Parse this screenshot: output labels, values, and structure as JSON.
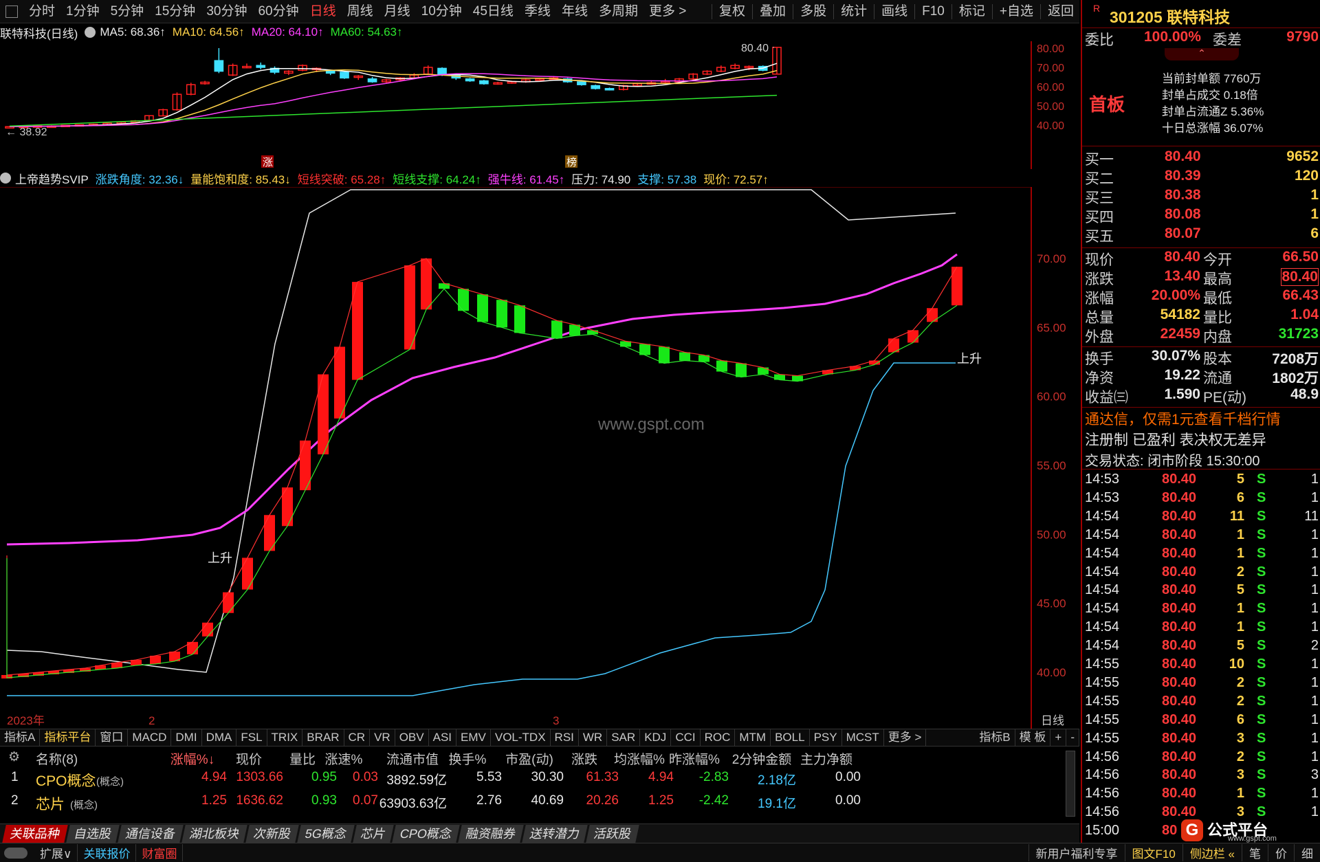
{
  "topbar": {
    "periods": [
      "分时",
      "1分钟",
      "5分钟",
      "15分钟",
      "30分钟",
      "60分钟",
      "日线",
      "周线",
      "月线",
      "10分钟",
      "45日线",
      "季线",
      "年线",
      "多周期",
      "更多 >"
    ],
    "active_period": "日线",
    "tools": [
      "复权",
      "叠加",
      "多股",
      "统计",
      "画线",
      "F10",
      "标记",
      "+自选",
      "返回"
    ]
  },
  "kline": {
    "title": "联特科技(日线)",
    "ma5": "MA5: 68.36↑",
    "ma10": "MA10: 64.56↑",
    "ma20": "MA20: 64.10↑",
    "ma60": "MA60: 54.63↑",
    "y_ticks": [
      "80.00",
      "70.00",
      "60.00",
      "50.00",
      "40.00"
    ],
    "high_label": "80.40",
    "low_label": "38.92",
    "marker_zhang": "涨",
    "marker_bang": "榜",
    "colors": {
      "up": "#ff2020",
      "down": "#40e0ff",
      "ma5": "#ffffff",
      "ma10": "#ffd24a",
      "ma20": "#ff40ff",
      "ma60": "#2ee62e"
    }
  },
  "indicator": {
    "name": "上帝趋势SVIP",
    "items": [
      {
        "text": "涨跌角度: 32.36↓",
        "color": "#45c8ff"
      },
      {
        "text": "量能饱和度: 85.43↓",
        "color": "#ffd24a"
      },
      {
        "text": "短线突破: 65.28↑",
        "color": "#ff3030"
      },
      {
        "text": "短线支撑: 64.24↑",
        "color": "#2ee62e"
      },
      {
        "text": "强牛线: 61.45↑",
        "color": "#ff40ff"
      },
      {
        "text": "压力: 74.90",
        "color": "#e8e8e8"
      },
      {
        "text": "支撑: 57.38",
        "color": "#45c8ff"
      },
      {
        "text": "现价: 72.57↑",
        "color": "#ffd24a"
      }
    ],
    "y_ticks": [
      "70.00",
      "65.00",
      "60.00",
      "55.00",
      "50.00",
      "45.00",
      "40.00"
    ],
    "label_rise": "上升",
    "watermark": "www.gspt.com",
    "x_labels": [
      "2023年",
      "2",
      "3"
    ],
    "period_label": "日线"
  },
  "indicator_tabs": [
    "指标A",
    "指标平台",
    "窗口",
    "MACD",
    "DMI",
    "DMA",
    "FSL",
    "TRIX",
    "BRAR",
    "CR",
    "VR",
    "OBV",
    "ASI",
    "EMV",
    "VOL-TDX",
    "RSI",
    "WR",
    "SAR",
    "KDJ",
    "CCI",
    "ROC",
    "MTM",
    "BOLL",
    "PSY",
    "MCST",
    "更多 >"
  ],
  "indicator_tabs_right": [
    "指标B",
    "模 板",
    "+",
    "-"
  ],
  "table": {
    "headers": [
      "名称(8)",
      "涨幅%↓",
      "现价",
      "量比",
      "涨速%",
      "流通市值",
      "换手%",
      "市盈(动)",
      "涨跌",
      "均涨幅%",
      "昨涨幅%",
      "2分钟金额",
      "主力净额"
    ],
    "rows": [
      {
        "idx": "1",
        "name": "CPO概念",
        "tag": "(概念)",
        "chg": "4.94",
        "price": "1303.66",
        "vr": "0.95",
        "speed": "0.03",
        "mcap": "3892.59亿",
        "turn": "5.53",
        "pe": "30.30",
        "zd": "61.33",
        "avg": "4.94",
        "yest": "-2.83",
        "amt": "2.18亿",
        "net": "0.00"
      },
      {
        "idx": "2",
        "name": "芯片",
        "tag": "(概念)",
        "chg": "1.25",
        "price": "1636.62",
        "vr": "0.93",
        "speed": "0.07",
        "mcap": "63903.63亿",
        "turn": "2.76",
        "pe": "40.69",
        "zd": "20.26",
        "avg": "1.25",
        "yest": "-2.42",
        "amt": "19.1亿",
        "net": "0.00"
      }
    ]
  },
  "bottom_tabs": [
    "关联品种",
    "自选股",
    "通信设备",
    "湖北板块",
    "次新股",
    "5G概念",
    "芯片",
    "CPO概念",
    "融资融券",
    "送转潜力",
    "活跃股"
  ],
  "statusbar": {
    "left": [
      "扩展∨",
      "关联报价",
      "财富圈"
    ],
    "right": [
      "新用户福利专享",
      "图文F10",
      "侧边栏 «",
      "笔",
      "价",
      "细"
    ]
  },
  "quote": {
    "flag": "R",
    "code_name": "301205 联特科技",
    "weibi_label": "委比",
    "weibi_value": "100.00%",
    "weicha_label": "委差",
    "weicha_value": "9790",
    "board": "首板",
    "seal_lines": [
      "当前封单额 7760万",
      "封单占成交 0.18倍",
      "封单占流通Z 5.36%",
      "十日总涨幅 36.07%"
    ],
    "buy": [
      {
        "label": "买一",
        "price": "80.40",
        "vol": "9652"
      },
      {
        "label": "买二",
        "price": "80.39",
        "vol": "120"
      },
      {
        "label": "买三",
        "price": "80.38",
        "vol": "1"
      },
      {
        "label": "买四",
        "price": "80.08",
        "vol": "1"
      },
      {
        "label": "买五",
        "price": "80.07",
        "vol": "6"
      }
    ],
    "stats": [
      {
        "l1": "现价",
        "v1": "80.40",
        "c1": "red",
        "l2": "今开",
        "v2": "66.50",
        "c2": "red"
      },
      {
        "l1": "涨跌",
        "v1": "13.40",
        "c1": "red",
        "l2": "最高",
        "v2": "80.40",
        "c2": "red"
      },
      {
        "l1": "涨幅",
        "v1": "20.00%",
        "c1": "red",
        "l2": "最低",
        "v2": "66.43",
        "c2": "red"
      },
      {
        "l1": "总量",
        "v1": "54182",
        "c1": "yel",
        "l2": "量比",
        "v2": "1.04",
        "c2": "red"
      },
      {
        "l1": "外盘",
        "v1": "22459",
        "c1": "red",
        "l2": "内盘",
        "v2": "31723",
        "c2": "grn"
      }
    ],
    "stats2": [
      {
        "l1": "换手",
        "v1": "30.07%",
        "l2": "股本",
        "v2": "7208万"
      },
      {
        "l1": "净资",
        "v1": "19.22",
        "l2": "流通",
        "v2": "1802万"
      },
      {
        "l1": "收益㈢",
        "v1": "1.590",
        "l2": "PE(动)",
        "v2": "48.9"
      }
    ],
    "promo": "通达信，仅需1元查看千档行情",
    "notice": "注册制 已盈利 表决权无差异",
    "trade_state": "交易状态: 闭市阶段 15:30:00"
  },
  "ticks": [
    {
      "t": "14:53",
      "p": "80.40",
      "v": "5",
      "s": "S",
      "n": "1"
    },
    {
      "t": "14:53",
      "p": "80.40",
      "v": "6",
      "s": "S",
      "n": "1"
    },
    {
      "t": "14:54",
      "p": "80.40",
      "v": "11",
      "s": "S",
      "n": "11"
    },
    {
      "t": "14:54",
      "p": "80.40",
      "v": "1",
      "s": "S",
      "n": "1"
    },
    {
      "t": "14:54",
      "p": "80.40",
      "v": "1",
      "s": "S",
      "n": "1"
    },
    {
      "t": "14:54",
      "p": "80.40",
      "v": "2",
      "s": "S",
      "n": "1"
    },
    {
      "t": "14:54",
      "p": "80.40",
      "v": "5",
      "s": "S",
      "n": "1"
    },
    {
      "t": "14:54",
      "p": "80.40",
      "v": "1",
      "s": "S",
      "n": "1"
    },
    {
      "t": "14:54",
      "p": "80.40",
      "v": "1",
      "s": "S",
      "n": "1"
    },
    {
      "t": "14:54",
      "p": "80.40",
      "v": "5",
      "s": "S",
      "n": "2"
    },
    {
      "t": "14:55",
      "p": "80.40",
      "v": "10",
      "s": "S",
      "n": "1"
    },
    {
      "t": "14:55",
      "p": "80.40",
      "v": "2",
      "s": "S",
      "n": "1"
    },
    {
      "t": "14:55",
      "p": "80.40",
      "v": "2",
      "s": "S",
      "n": "1"
    },
    {
      "t": "14:55",
      "p": "80.40",
      "v": "6",
      "s": "S",
      "n": "1"
    },
    {
      "t": "14:55",
      "p": "80.40",
      "v": "3",
      "s": "S",
      "n": "1"
    },
    {
      "t": "14:56",
      "p": "80.40",
      "v": "2",
      "s": "S",
      "n": "1"
    },
    {
      "t": "14:56",
      "p": "80.40",
      "v": "3",
      "s": "S",
      "n": "3"
    },
    {
      "t": "14:56",
      "p": "80.40",
      "v": "1",
      "s": "S",
      "n": "1"
    },
    {
      "t": "14:56",
      "p": "80.40",
      "v": "3",
      "s": "S",
      "n": "1"
    },
    {
      "t": "15:00",
      "p": "80",
      "v": "",
      "s": "",
      "n": ""
    }
  ],
  "logo": {
    "glyph": "G",
    "text": "公式平台",
    "url": "www.gspt.com"
  }
}
